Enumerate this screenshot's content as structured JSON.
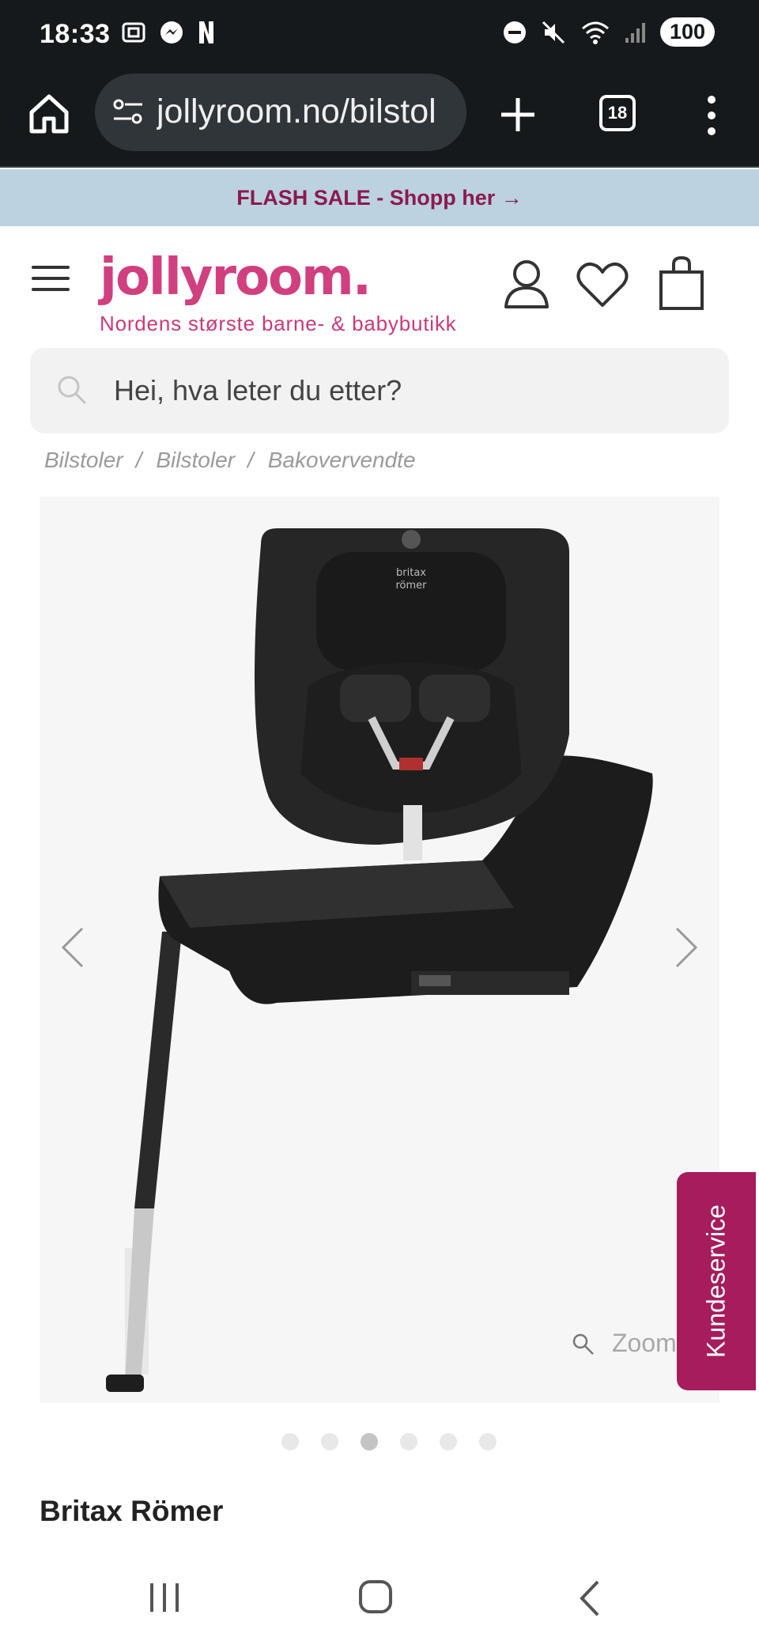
{
  "status_bar": {
    "time": "18:33",
    "battery": "100",
    "left_icons": [
      "screenshot-icon",
      "messenger-icon",
      "netflix-icon"
    ],
    "right_icons": [
      "dnd-icon",
      "mute-icon",
      "wifi-icon",
      "signal-icon"
    ]
  },
  "browser": {
    "url": "jollyroom.no/bilstol",
    "tab_count": "18"
  },
  "banner": {
    "text": "FLASH SALE - Shopp her →"
  },
  "header": {
    "logo": "jollyroom.",
    "tagline": "Nordens største barne- & babybutikk"
  },
  "search": {
    "placeholder": "Hei, hva leter du etter?"
  },
  "breadcrumb": {
    "items": [
      "Bilstoler",
      "Bilstoler",
      "Bakovervendte"
    ],
    "separator": "/"
  },
  "product": {
    "zoom_label": "Zoom",
    "image_count": 6,
    "active_image_index": 3,
    "brand": "Britax Römer",
    "seat_branding": "britax römer"
  },
  "support": {
    "label": "Kundeservice"
  },
  "colors": {
    "status_bg": "#16191c",
    "banner_bg": "#bcd2e0",
    "banner_text": "#8b1a4f",
    "brand_pink": "#d0407f",
    "support_bg": "#a61c5c"
  }
}
